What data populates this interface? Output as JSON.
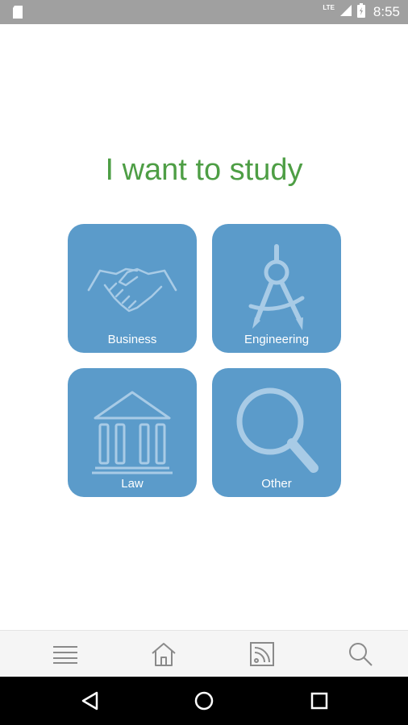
{
  "status_bar": {
    "time": "8:55",
    "network": "LTE",
    "icons": [
      "sd-card-icon",
      "signal-icon",
      "battery-icon"
    ]
  },
  "page": {
    "title": "I want to study"
  },
  "categories": [
    {
      "label": "Business",
      "icon": "handshake-icon"
    },
    {
      "label": "Engineering",
      "icon": "compass-icon"
    },
    {
      "label": "Law",
      "icon": "courthouse-icon"
    },
    {
      "label": "Other",
      "icon": "magnifier-icon"
    }
  ],
  "bottom_nav": {
    "items": [
      "menu-icon",
      "home-icon",
      "rss-icon",
      "search-icon"
    ]
  },
  "system_nav": {
    "items": [
      "back-icon",
      "home-circle-icon",
      "recents-icon"
    ]
  },
  "colors": {
    "title": "#4e9e45",
    "tile": "#5b9bca",
    "tile_icon": "#9cc4e3",
    "status_bar": "#a0a0a0",
    "nav_icon": "#8a8a8a"
  }
}
